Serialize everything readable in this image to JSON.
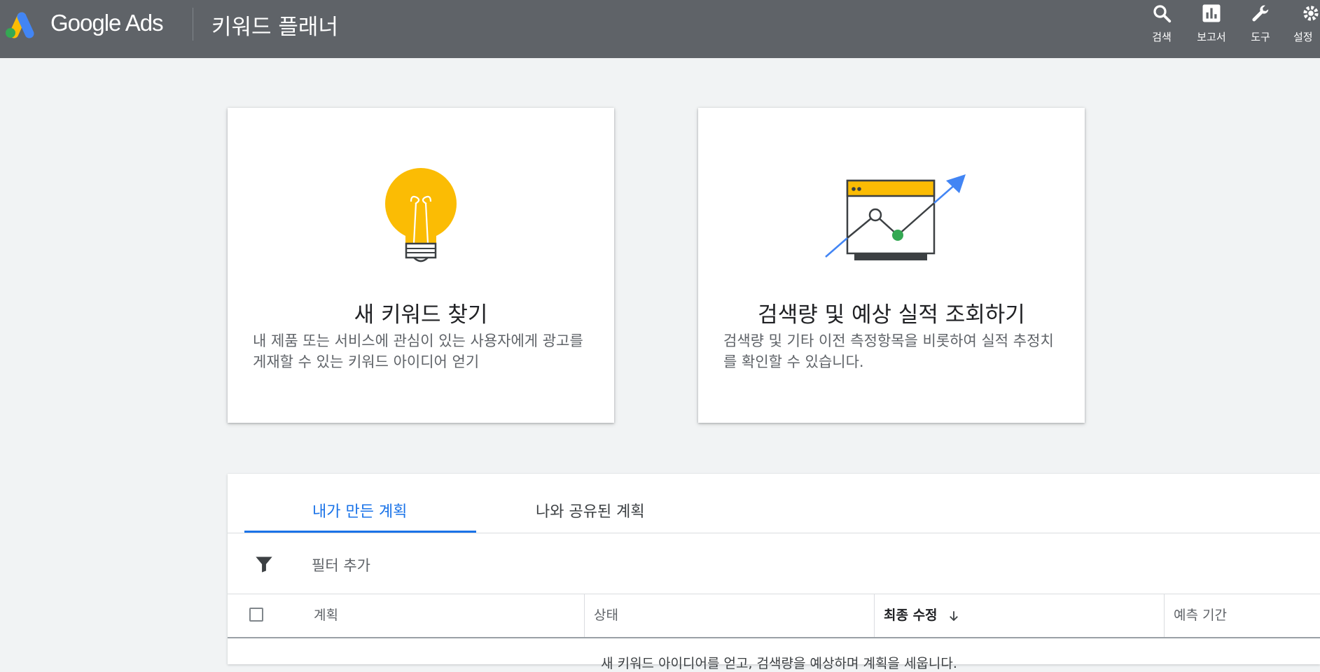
{
  "header": {
    "brand": "Google Ads",
    "page_title": "키워드 플래너",
    "tools": [
      {
        "label": "검색",
        "icon": "search-icon"
      },
      {
        "label": "보고서",
        "icon": "reports-icon"
      },
      {
        "label": "도구",
        "icon": "wrench-icon"
      },
      {
        "label": "설정",
        "icon": "gear-icon"
      }
    ]
  },
  "cards": [
    {
      "title": "새 키워드 찾기",
      "description": "내 제품 또는 서비스에 관심이 있는 사용자에게 광고를 게재할 수 있는 키워드 아이디어 얻기",
      "icon": "lightbulb-icon"
    },
    {
      "title": "검색량 및 예상 실적 조회하기",
      "description": "검색량 및 기타 이전 측정항목을 비롯하여 실적 추정치를 확인할 수 있습니다.",
      "icon": "growth-chart-icon"
    }
  ],
  "plans": {
    "tabs": [
      "내가 만든 계획",
      "나와 공유된 계획"
    ],
    "active_tab": 0,
    "filter_label": "필터 추가",
    "columns": [
      "계획",
      "상태",
      "최종 수정",
      "예측 기간"
    ],
    "sorted_column": "최종 수정",
    "sort_direction": "descending",
    "empty_message": "새 키워드 아이디어를 얻고, 검색량을 예상하며 계획을 세웁니다."
  },
  "colors": {
    "header_bg": "#5f6368",
    "page_bg": "#f1f3f4",
    "accent": "#1a73e8",
    "bulb_yellow": "#fbbc04",
    "chart_arrow": "#4285f4",
    "chart_point": "#34a853"
  }
}
